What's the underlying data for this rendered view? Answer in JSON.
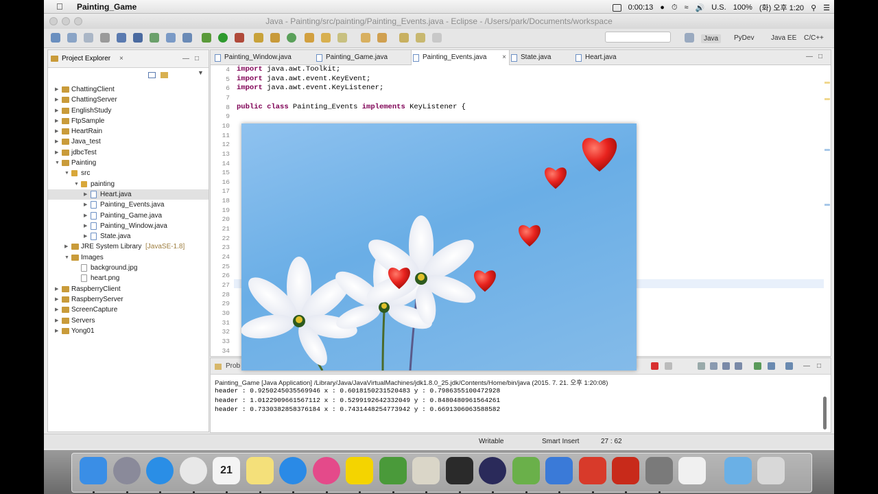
{
  "menubar": {
    "app_name": "Painting_Game",
    "timer": "0:00:13",
    "battery_pct": "100%",
    "input_source": "U.S.",
    "clock": "(화) 오후 1:20"
  },
  "window": {
    "title": "Java - Painting/src/painting/Painting_Events.java - Eclipse - /Users/park/Documents/workspace"
  },
  "perspectives": [
    "Java",
    "PyDev",
    "Java EE",
    "C/C++"
  ],
  "explorer": {
    "title": "Project Explorer",
    "items": [
      {
        "label": "ChattingClient",
        "type": "proj",
        "depth": 0,
        "expanded": false
      },
      {
        "label": "ChattingServer",
        "type": "proj",
        "depth": 0,
        "expanded": false
      },
      {
        "label": "EnglishStudy",
        "type": "proj",
        "depth": 0,
        "expanded": false
      },
      {
        "label": "FtpSample",
        "type": "proj",
        "depth": 0,
        "expanded": false
      },
      {
        "label": "HeartRain",
        "type": "proj",
        "depth": 0,
        "expanded": false
      },
      {
        "label": "Java_test",
        "type": "proj",
        "depth": 0,
        "expanded": false
      },
      {
        "label": "jdbcTest",
        "type": "proj",
        "depth": 0,
        "expanded": false
      },
      {
        "label": "Painting",
        "type": "proj",
        "depth": 0,
        "expanded": true
      },
      {
        "label": "src",
        "type": "pkg",
        "depth": 1,
        "expanded": true
      },
      {
        "label": "painting",
        "type": "pkg",
        "depth": 2,
        "expanded": true
      },
      {
        "label": "Heart.java",
        "type": "file",
        "depth": 3,
        "expanded": false,
        "selected": true
      },
      {
        "label": "Painting_Events.java",
        "type": "file",
        "depth": 3,
        "expanded": false
      },
      {
        "label": "Painting_Game.java",
        "type": "file",
        "depth": 3,
        "expanded": false
      },
      {
        "label": "Painting_Window.java",
        "type": "file",
        "depth": 3,
        "expanded": false
      },
      {
        "label": "State.java",
        "type": "file",
        "depth": 3,
        "expanded": false
      },
      {
        "label": "JRE System Library",
        "sub": "[JavaSE-1.8]",
        "type": "proj",
        "depth": 1,
        "expanded": false
      },
      {
        "label": "Images",
        "type": "proj",
        "depth": 1,
        "expanded": true
      },
      {
        "label": "background.jpg",
        "type": "img",
        "depth": 2,
        "leaf": true
      },
      {
        "label": "heart.png",
        "type": "img",
        "depth": 2,
        "leaf": true
      },
      {
        "label": "RaspberryClient",
        "type": "proj",
        "depth": 0,
        "expanded": false
      },
      {
        "label": "RaspberryServer",
        "type": "proj",
        "depth": 0,
        "expanded": false
      },
      {
        "label": "ScreenCapture",
        "type": "proj",
        "depth": 0,
        "expanded": false
      },
      {
        "label": "Servers",
        "type": "proj",
        "depth": 0,
        "expanded": false
      },
      {
        "label": "Yong01",
        "type": "proj",
        "depth": 0,
        "expanded": false
      }
    ]
  },
  "editor": {
    "tabs": [
      {
        "label": "Painting_Window.java",
        "active": false
      },
      {
        "label": "Painting_Game.java",
        "active": false
      },
      {
        "label": "Painting_Events.java",
        "active": true
      },
      {
        "label": "State.java",
        "active": false
      },
      {
        "label": "Heart.java",
        "active": false
      }
    ],
    "line_numbers": [
      "4",
      "5",
      "6",
      "7",
      "8",
      "9",
      "10",
      "11",
      "12",
      "13",
      "14",
      "15",
      "16",
      "17",
      "18",
      "19",
      "20",
      "21",
      "22",
      "23",
      "24",
      "25",
      "26",
      "27",
      "28",
      "29",
      "30",
      "31",
      "32",
      "33",
      "34"
    ],
    "code": [
      {
        "text": "import java.awt.Toolkit;",
        "kw": "import"
      },
      {
        "text": "import java.awt.event.KeyEvent;",
        "kw": "import"
      },
      {
        "text": "import java.awt.event.KeyListener;",
        "kw": "import"
      },
      {
        "text": "",
        "kw": ""
      },
      {
        "text": "public class Painting_Events implements KeyListener {",
        "kw": "public class"
      }
    ]
  },
  "console": {
    "tab_label": "Prob",
    "header": "Painting_Game [Java Application] /Library/Java/JavaVirtualMachines/jdk1.8.0_25.jdk/Contents/Home/bin/java (2015. 7. 21. 오후 1:20:08)",
    "lines": [
      "header : 0.9250245035569946 x : 0.6018150231520483 y : 0.7986355100472928",
      "header : 1.0122909661567112 x : 0.5299192642332049 y : 0.8480480961564261",
      "header : 0.7330382858376184 x : 0.7431448254773942 y : 0.6691306063588582"
    ]
  },
  "status": {
    "writable": "Writable",
    "insert_mode": "Smart Insert",
    "position": "27 : 62"
  },
  "dock": {
    "calendar_day": "21",
    "apps": [
      "finder-icon",
      "launchpad-icon",
      "safari-icon",
      "chrome-icon",
      "calendar-icon",
      "notes-icon",
      "app-store-icon",
      "itunes-icon",
      "kakaotalk-icon",
      "evernote-icon",
      "photo-icon",
      "terminal-icon",
      "eclipse-icon",
      "android-studio-icon",
      "xcode-icon",
      "filezilla-icon",
      "filezilla-icon",
      "system-preferences-icon",
      "java-icon",
      "folder-icon",
      "trash-icon"
    ]
  },
  "colors": {
    "keyword": "#7f0055",
    "sky": "#7ab8eb",
    "heart": "#e8231e"
  }
}
